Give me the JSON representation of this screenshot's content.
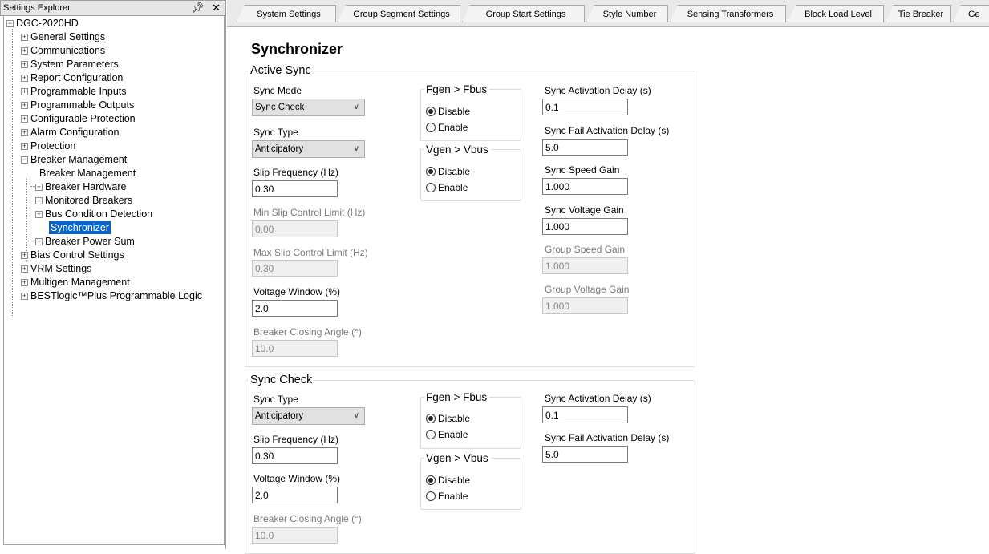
{
  "explorer": {
    "title": "Settings Explorer",
    "pin_icon": "pin-icon",
    "close_icon": "close-icon",
    "root": "DGC-2020HD",
    "items": [
      {
        "label": "General Settings"
      },
      {
        "label": "Communications"
      },
      {
        "label": "System Parameters"
      },
      {
        "label": "Report Configuration"
      },
      {
        "label": "Programmable Inputs"
      },
      {
        "label": "Programmable Outputs"
      },
      {
        "label": "Configurable Protection"
      },
      {
        "label": "Alarm Configuration"
      },
      {
        "label": "Protection"
      },
      {
        "label": "Breaker Management"
      },
      {
        "label": "Breaker Management"
      },
      {
        "label": "Breaker Hardware"
      },
      {
        "label": "Monitored Breakers"
      },
      {
        "label": "Bus Condition Detection"
      },
      {
        "label": "Synchronizer"
      },
      {
        "label": "Breaker Power Sum"
      },
      {
        "label": "Bias Control Settings"
      },
      {
        "label": "VRM Settings"
      },
      {
        "label": "Multigen Management"
      },
      {
        "label": "BESTlogic™Plus Programmable Logic"
      }
    ]
  },
  "tabs": [
    {
      "label": "System Settings"
    },
    {
      "label": "Group Segment Settings"
    },
    {
      "label": "Group Start Settings"
    },
    {
      "label": "Style Number"
    },
    {
      "label": "Sensing Transformers"
    },
    {
      "label": "Block Load Level"
    },
    {
      "label": "Tie Breaker"
    },
    {
      "label": "Ge"
    }
  ],
  "page_title": "Synchronizer",
  "active_sync": {
    "legend": "Active Sync",
    "sync_mode_label": "Sync Mode",
    "sync_mode_value": "Sync Check",
    "sync_type_label": "Sync Type",
    "sync_type_value": "Anticipatory",
    "slip_freq_label": "Slip Frequency (Hz)",
    "slip_freq_value": "0.30",
    "min_slip_label": "Min Slip Control Limit (Hz)",
    "min_slip_value": "0.00",
    "max_slip_label": "Max Slip Control Limit (Hz)",
    "max_slip_value": "0.30",
    "volt_window_label": "Voltage Window (%)",
    "volt_window_value": "2.0",
    "closing_angle_label": "Breaker Closing Angle (°)",
    "closing_angle_value": "10.0",
    "fgen": {
      "legend": "Fgen > Fbus",
      "disable": "Disable",
      "enable": "Enable",
      "selected": "disable"
    },
    "vgen": {
      "legend": "Vgen > Vbus",
      "disable": "Disable",
      "enable": "Enable",
      "selected": "disable"
    },
    "act_delay_label": "Sync Activation Delay (s)",
    "act_delay_value": "0.1",
    "fail_delay_label": "Sync Fail Activation Delay (s)",
    "fail_delay_value": "5.0",
    "speed_gain_label": "Sync Speed Gain",
    "speed_gain_value": "1.000",
    "volt_gain_label": "Sync Voltage Gain",
    "volt_gain_value": "1.000",
    "grp_speed_label": "Group Speed Gain",
    "grp_speed_value": "1.000",
    "grp_volt_label": "Group Voltage Gain",
    "grp_volt_value": "1.000"
  },
  "sync_check": {
    "legend": "Sync Check",
    "sync_type_label": "Sync Type",
    "sync_type_value": "Anticipatory",
    "slip_freq_label": "Slip Frequency (Hz)",
    "slip_freq_value": "0.30",
    "volt_window_label": "Voltage Window (%)",
    "volt_window_value": "2.0",
    "closing_angle_label": "Breaker Closing Angle (°)",
    "closing_angle_value": "10.0",
    "fgen": {
      "legend": "Fgen > Fbus",
      "disable": "Disable",
      "enable": "Enable",
      "selected": "disable"
    },
    "vgen": {
      "legend": "Vgen > Vbus",
      "disable": "Disable",
      "enable": "Enable",
      "selected": "disable"
    },
    "act_delay_label": "Sync Activation Delay (s)",
    "act_delay_value": "0.1",
    "fail_delay_label": "Sync Fail Activation Delay (s)",
    "fail_delay_value": "5.0"
  },
  "colors": {
    "selection": "#0a64c8",
    "tab_strip": "#e9e9e9",
    "disabled_text": "#7a7a7a"
  }
}
